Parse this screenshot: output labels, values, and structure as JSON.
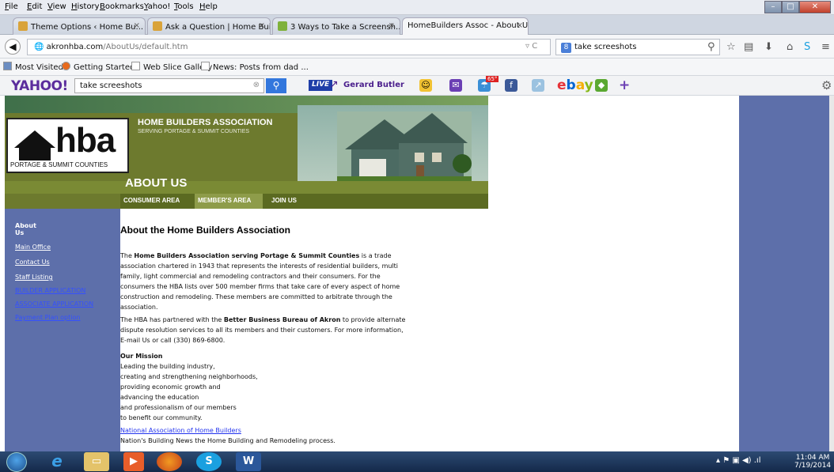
{
  "menubar": {
    "items": [
      "File",
      "Edit",
      "View",
      "History",
      "Bookmarks",
      "Yahoo!",
      "Tools",
      "Help"
    ]
  },
  "tabs": [
    {
      "label": "Theme Options ‹ Home Bu...",
      "active": false
    },
    {
      "label": "Ask a Question | Home Bui...",
      "active": false
    },
    {
      "label": "3 Ways to Take a Screensh...",
      "active": false
    },
    {
      "label": "HomeBuilders Assoc - About Us",
      "active": true
    }
  ],
  "navbar": {
    "url_domain": "akronhba.com",
    "url_path": "/AboutUs/default.htm",
    "search_value": "take screeshots"
  },
  "bookmarks": [
    "Most Visited",
    "Getting Started",
    "Web Slice Gallery",
    "News: Posts from dad ..."
  ],
  "yahoo_toolbar": {
    "logo": "YAHOO!",
    "search_value": "take screeshots",
    "live": "LIVE",
    "trending": "Gerard Butler",
    "ebay": "ebay",
    "weather_badge": "65°"
  },
  "header": {
    "logo_text": "hba",
    "logo_sub": "PORTAGE & SUMMIT COUNTIES",
    "title": "HOME BUILDERS ASSOCIATION",
    "subtitle": "SERVING PORTAGE & SUMMIT COUNTIES",
    "section": "ABOUT US",
    "menu": [
      "CONSUMER AREA",
      "MEMBER'S AREA",
      "JOIN US"
    ]
  },
  "left_nav": {
    "about": "About Us",
    "items": [
      {
        "label": "Main Office",
        "style": "white"
      },
      {
        "label": "Contact Us",
        "style": "white"
      },
      {
        "label": "Staff Listing",
        "style": "white"
      },
      {
        "label": "BUILDER APPLICATION",
        "style": "blue"
      },
      {
        "label": "ASSOCIATE APPLICATION",
        "style": "blue"
      },
      {
        "label": "Payment Plan option",
        "style": "blue"
      }
    ]
  },
  "main": {
    "title": "About the Home Builders Association",
    "p1_pre": "The ",
    "p1_bold": "Home Builders Association serving Portage & Summit Counties",
    "p1_lines": [
      " is a trade",
      "association chartered in 1943 that represents the interests of residential builders, multi",
      "family, light commercial and remodeling contractors and their consumers. For the",
      "consumers the HBA lists over 500 member firms that take care of every aspect of home",
      "construction and remodeling. These members are committed to arbitrate through the",
      "association."
    ],
    "p2_pre": "The HBA has partnered with the ",
    "p2_bold": "Better Business Bureau of Akron",
    "p2_lines": [
      " to provide alternate",
      "dispute resolution services to all its members and their customers. For more information,",
      "E-mail Us or call (330) 869-6800."
    ],
    "mission_title": "Our Mission",
    "mission_lines": [
      "Leading the building industry,",
      "creating and strengthening neighborhoods,",
      "providing economic growth and",
      "advancing the education",
      "and professionalism of our members",
      "to benefit our community."
    ],
    "nahb_link": "National Association of Home Builders",
    "nahb_text": "Nation's Building News the Home Building and Remodeling process."
  },
  "taskbar": {
    "time": "11:04 AM",
    "date": "7/19/2014"
  },
  "colors": {
    "nav_blue": "#5d6faa",
    "header_olive": "#6d7a2e",
    "link_blue": "#2233ee"
  }
}
